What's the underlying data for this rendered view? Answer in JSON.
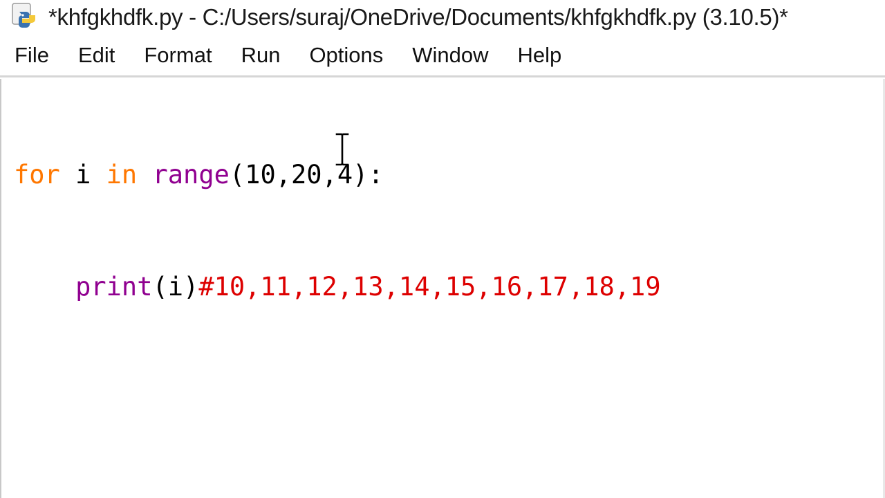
{
  "window": {
    "title": "*khfgkhdfk.py - C:/Users/suraj/OneDrive/Documents/khfgkhdfk.py (3.10.5)*"
  },
  "menu": {
    "items": [
      "File",
      "Edit",
      "Format",
      "Run",
      "Options",
      "Window",
      "Help"
    ]
  },
  "editor": {
    "line1": {
      "kw_for": "for",
      "var_i": " i ",
      "kw_in": "in",
      "space": " ",
      "builtin_range": "range",
      "args": "(10,20,4):"
    },
    "line2": {
      "indent": "    ",
      "builtin_print": "print",
      "args": "(i)",
      "comment": "#10,11,12,13,14,15,16,17,18,19"
    }
  },
  "colors": {
    "keyword": "#ff7700",
    "builtin": "#900090",
    "comment": "#dd0000",
    "default": "#000000"
  },
  "icons": {
    "app": "python-idle-icon",
    "cursor": "text-cursor-ibeam-icon"
  }
}
